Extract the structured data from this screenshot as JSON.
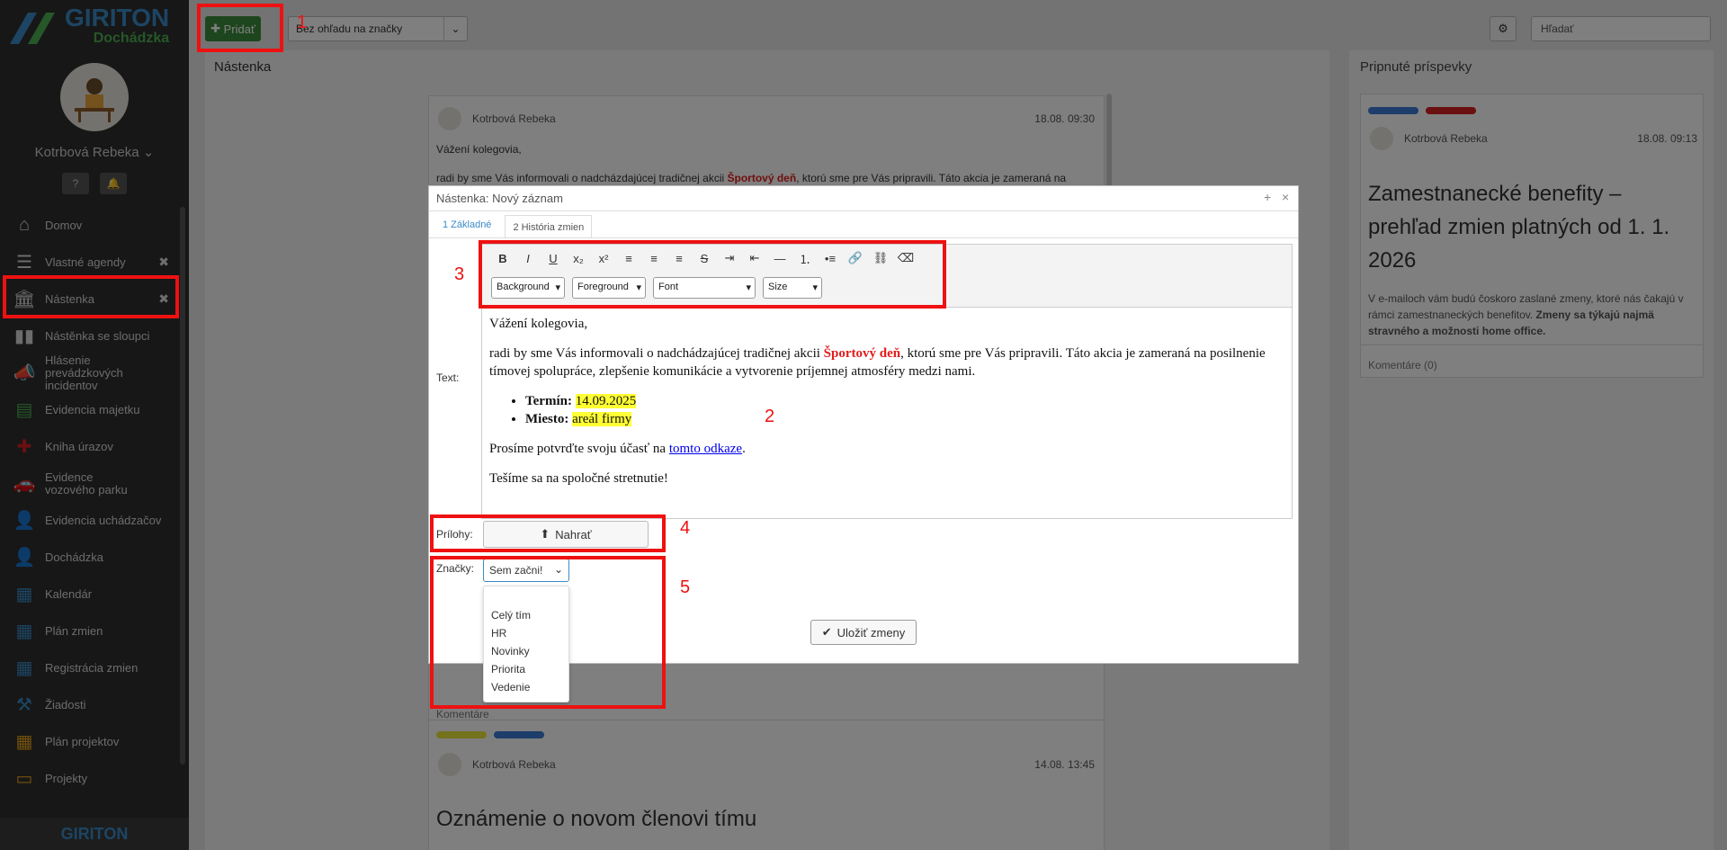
{
  "app": {
    "logo_text": "GIRITON",
    "logo_sub": "Dochádzka",
    "user_name": "Kotrbová Rebeka",
    "footer_logo": "GIRITON"
  },
  "sidebar": {
    "items": [
      {
        "label": "Domov",
        "icon": "home-icon"
      },
      {
        "label": "Vlastné agendy",
        "icon": "list-icon"
      },
      {
        "label": "Nástenka",
        "icon": "bank-icon"
      },
      {
        "label": "Nástěnka se sloupci",
        "icon": "columns-icon"
      },
      {
        "label": "Hlásenie prevádzkových incidentov",
        "icon": "megaphone-icon"
      },
      {
        "label": "Evidencia majetku",
        "icon": "box-icon"
      },
      {
        "label": "Kniha úrazov",
        "icon": "first-aid-icon"
      },
      {
        "label": "Evidence vozového parku",
        "icon": "car-icon"
      },
      {
        "label": "Evidencia uchádzačov",
        "icon": "user-plus-icon"
      },
      {
        "label": "Dochádzka",
        "icon": "user-icon"
      },
      {
        "label": "Kalendár",
        "icon": "calendar-icon"
      },
      {
        "label": "Plán zmien",
        "icon": "calendar-grid-icon"
      },
      {
        "label": "Registrácia zmien",
        "icon": "calendar-check-icon"
      },
      {
        "label": "Žiadosti",
        "icon": "gavel-icon"
      },
      {
        "label": "Plán projektov",
        "icon": "calendar-project-icon"
      },
      {
        "label": "Projekty",
        "icon": "folder-icon"
      }
    ]
  },
  "topbar": {
    "add_label": "Pridať",
    "filter_value": "Bez ohľadu na značky",
    "search_placeholder": "Hľadať"
  },
  "board": {
    "title": "Nástenka",
    "post1": {
      "author": "Kotrbová Rebeka",
      "time": "18.08. 09:30",
      "greeting": "Vážení kolegovia,",
      "snippet_start": "radi by sme Vás informovali o nadcházdajúcej tradičnej akcii ",
      "snippet_red": "Športový deň",
      "snippet_end": ", ktorú sme pre Vás pripravili. Táto akcia je zameraná na",
      "comments": "Komentáre"
    },
    "post2": {
      "author": "Kotrbová Rebeka",
      "time": "14.08. 13:45",
      "title": "Oznámenie o novom členovi tímu"
    }
  },
  "pinned": {
    "title": "Pripnuté príspevky",
    "author": "Kotrbová Rebeka",
    "time": "18.08. 09:13",
    "headline": "Zamestnanecké benefity – prehľad zmien platných od 1. 1. 2026",
    "body_normal": "V e-mailoch vám budú čoskoro zaslané zmeny, ktoré nás čakajú v rámci zamestnaneckých benefitov. ",
    "body_bold": "Zmeny sa týkajú najmä stravného a možnosti home office.",
    "comments": "Komentáre (0)",
    "pill_colors": [
      "#3a7bd5",
      "#d62020"
    ]
  },
  "modal": {
    "title": "Nástenka: Nový záznam",
    "tabs": [
      "1 Základné",
      "2 História zmien"
    ],
    "text_label": "Text:",
    "attachments_label": "Prílohy:",
    "upload_label": "Nahrať",
    "tags_label": "Značky:",
    "tags_placeholder": "Sem začni!",
    "tag_options": [
      "Celý tím",
      "HR",
      "Novinky",
      "Priorita",
      "Vedenie"
    ],
    "save_label": "Uložiť zmeny",
    "toolbar_selects": [
      "Background",
      "Foreground",
      "Font",
      "Size"
    ],
    "content": {
      "greeting": "Vážení kolegovia,",
      "p1_start": "radi by sme Vás informovali o nadchádzajúcej tradičnej akcii ",
      "p1_red": "Športový deň",
      "p1_end": ", ktorú sme pre Vás pripravili. Táto akcia je zameraná na posilnenie tímovej spolupráce, zlepšenie komunikácie a vytvorenie príjemnej atmosféry medzi nami.",
      "term_label": "Termín:",
      "term_value": "14.09.2025",
      "place_label": "Miesto:",
      "place_value": "areál firmy",
      "confirm_start": "Prosíme potvrďte svoju účasť na ",
      "confirm_link": "tomto odkaze",
      "confirm_end": ".",
      "closing": "Tešíme sa na spoločné stretnutie!"
    }
  },
  "annotations": [
    "1",
    "2",
    "3",
    "4",
    "5"
  ]
}
